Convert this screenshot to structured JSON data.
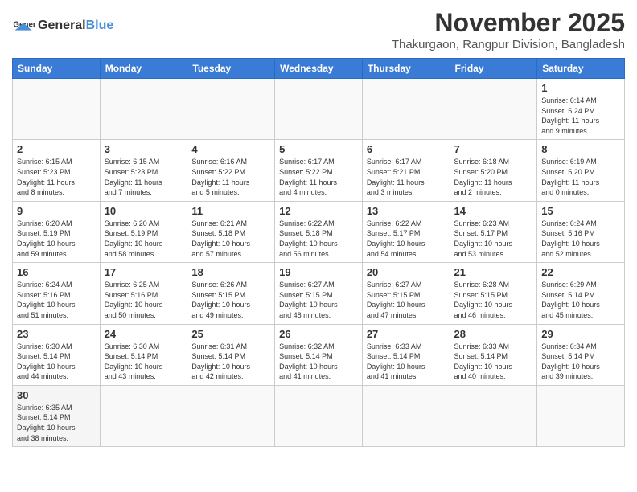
{
  "header": {
    "logo_general": "General",
    "logo_blue": "Blue",
    "month": "November 2025",
    "location": "Thakurgaon, Rangpur Division, Bangladesh"
  },
  "weekdays": [
    "Sunday",
    "Monday",
    "Tuesday",
    "Wednesday",
    "Thursday",
    "Friday",
    "Saturday"
  ],
  "weeks": [
    [
      {
        "day": "",
        "info": ""
      },
      {
        "day": "",
        "info": ""
      },
      {
        "day": "",
        "info": ""
      },
      {
        "day": "",
        "info": ""
      },
      {
        "day": "",
        "info": ""
      },
      {
        "day": "",
        "info": ""
      },
      {
        "day": "1",
        "info": "Sunrise: 6:14 AM\nSunset: 5:24 PM\nDaylight: 11 hours\nand 9 minutes."
      }
    ],
    [
      {
        "day": "2",
        "info": "Sunrise: 6:15 AM\nSunset: 5:23 PM\nDaylight: 11 hours\nand 8 minutes."
      },
      {
        "day": "3",
        "info": "Sunrise: 6:15 AM\nSunset: 5:23 PM\nDaylight: 11 hours\nand 7 minutes."
      },
      {
        "day": "4",
        "info": "Sunrise: 6:16 AM\nSunset: 5:22 PM\nDaylight: 11 hours\nand 5 minutes."
      },
      {
        "day": "5",
        "info": "Sunrise: 6:17 AM\nSunset: 5:22 PM\nDaylight: 11 hours\nand 4 minutes."
      },
      {
        "day": "6",
        "info": "Sunrise: 6:17 AM\nSunset: 5:21 PM\nDaylight: 11 hours\nand 3 minutes."
      },
      {
        "day": "7",
        "info": "Sunrise: 6:18 AM\nSunset: 5:20 PM\nDaylight: 11 hours\nand 2 minutes."
      },
      {
        "day": "8",
        "info": "Sunrise: 6:19 AM\nSunset: 5:20 PM\nDaylight: 11 hours\nand 0 minutes."
      }
    ],
    [
      {
        "day": "9",
        "info": "Sunrise: 6:20 AM\nSunset: 5:19 PM\nDaylight: 10 hours\nand 59 minutes."
      },
      {
        "day": "10",
        "info": "Sunrise: 6:20 AM\nSunset: 5:19 PM\nDaylight: 10 hours\nand 58 minutes."
      },
      {
        "day": "11",
        "info": "Sunrise: 6:21 AM\nSunset: 5:18 PM\nDaylight: 10 hours\nand 57 minutes."
      },
      {
        "day": "12",
        "info": "Sunrise: 6:22 AM\nSunset: 5:18 PM\nDaylight: 10 hours\nand 56 minutes."
      },
      {
        "day": "13",
        "info": "Sunrise: 6:22 AM\nSunset: 5:17 PM\nDaylight: 10 hours\nand 54 minutes."
      },
      {
        "day": "14",
        "info": "Sunrise: 6:23 AM\nSunset: 5:17 PM\nDaylight: 10 hours\nand 53 minutes."
      },
      {
        "day": "15",
        "info": "Sunrise: 6:24 AM\nSunset: 5:16 PM\nDaylight: 10 hours\nand 52 minutes."
      }
    ],
    [
      {
        "day": "16",
        "info": "Sunrise: 6:24 AM\nSunset: 5:16 PM\nDaylight: 10 hours\nand 51 minutes."
      },
      {
        "day": "17",
        "info": "Sunrise: 6:25 AM\nSunset: 5:16 PM\nDaylight: 10 hours\nand 50 minutes."
      },
      {
        "day": "18",
        "info": "Sunrise: 6:26 AM\nSunset: 5:15 PM\nDaylight: 10 hours\nand 49 minutes."
      },
      {
        "day": "19",
        "info": "Sunrise: 6:27 AM\nSunset: 5:15 PM\nDaylight: 10 hours\nand 48 minutes."
      },
      {
        "day": "20",
        "info": "Sunrise: 6:27 AM\nSunset: 5:15 PM\nDaylight: 10 hours\nand 47 minutes."
      },
      {
        "day": "21",
        "info": "Sunrise: 6:28 AM\nSunset: 5:15 PM\nDaylight: 10 hours\nand 46 minutes."
      },
      {
        "day": "22",
        "info": "Sunrise: 6:29 AM\nSunset: 5:14 PM\nDaylight: 10 hours\nand 45 minutes."
      }
    ],
    [
      {
        "day": "23",
        "info": "Sunrise: 6:30 AM\nSunset: 5:14 PM\nDaylight: 10 hours\nand 44 minutes."
      },
      {
        "day": "24",
        "info": "Sunrise: 6:30 AM\nSunset: 5:14 PM\nDaylight: 10 hours\nand 43 minutes."
      },
      {
        "day": "25",
        "info": "Sunrise: 6:31 AM\nSunset: 5:14 PM\nDaylight: 10 hours\nand 42 minutes."
      },
      {
        "day": "26",
        "info": "Sunrise: 6:32 AM\nSunset: 5:14 PM\nDaylight: 10 hours\nand 41 minutes."
      },
      {
        "day": "27",
        "info": "Sunrise: 6:33 AM\nSunset: 5:14 PM\nDaylight: 10 hours\nand 41 minutes."
      },
      {
        "day": "28",
        "info": "Sunrise: 6:33 AM\nSunset: 5:14 PM\nDaylight: 10 hours\nand 40 minutes."
      },
      {
        "day": "29",
        "info": "Sunrise: 6:34 AM\nSunset: 5:14 PM\nDaylight: 10 hours\nand 39 minutes."
      }
    ],
    [
      {
        "day": "30",
        "info": "Sunrise: 6:35 AM\nSunset: 5:14 PM\nDaylight: 10 hours\nand 38 minutes."
      },
      {
        "day": "",
        "info": ""
      },
      {
        "day": "",
        "info": ""
      },
      {
        "day": "",
        "info": ""
      },
      {
        "day": "",
        "info": ""
      },
      {
        "day": "",
        "info": ""
      },
      {
        "day": "",
        "info": ""
      }
    ]
  ]
}
